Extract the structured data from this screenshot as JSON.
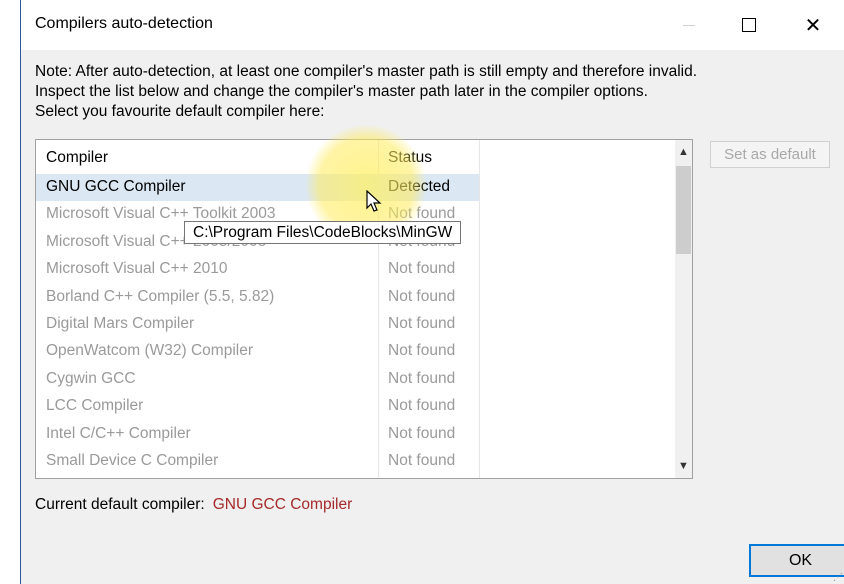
{
  "window": {
    "title": "Compilers auto-detection",
    "minimize_icon": "minimize-icon",
    "maximize_icon": "maximize-icon",
    "close_icon": "close-icon",
    "close_glyph": "✕"
  },
  "note": {
    "line1": "Note: After auto-detection, at least one compiler's master path is still empty and therefore invalid.",
    "line2": "Inspect the list below and change the compiler's master path later in the compiler options.",
    "line3": "Select you favourite default compiler here:"
  },
  "list": {
    "columns": [
      "Compiler",
      "Status"
    ],
    "rows": [
      {
        "compiler": "GNU GCC Compiler",
        "status": "Detected"
      },
      {
        "compiler": "Microsoft Visual C++ Toolkit 2003",
        "status": "Not found"
      },
      {
        "compiler": "Microsoft Visual C++ 2005/2008",
        "status": "Not found"
      },
      {
        "compiler": "Microsoft Visual C++ 2010",
        "status": "Not found"
      },
      {
        "compiler": "Borland C++ Compiler (5.5, 5.82)",
        "status": "Not found"
      },
      {
        "compiler": "Digital Mars Compiler",
        "status": "Not found"
      },
      {
        "compiler": "OpenWatcom (W32) Compiler",
        "status": "Not found"
      },
      {
        "compiler": "Cygwin GCC",
        "status": "Not found"
      },
      {
        "compiler": "LCC Compiler",
        "status": "Not found"
      },
      {
        "compiler": "Intel C/C++ Compiler",
        "status": "Not found"
      },
      {
        "compiler": "Small Device C Compiler",
        "status": "Not found"
      }
    ],
    "tooltip": "C:\\Program Files\\CodeBlocks\\MinGW"
  },
  "buttons": {
    "set_default": "Set as default",
    "ok": "OK"
  },
  "current": {
    "label": "Current default compiler:",
    "value": "GNU GCC Compiler"
  },
  "colors": {
    "current_value": "#a52a2a",
    "selected_row": "#dbe8f4",
    "ok_border": "#0078d7"
  }
}
